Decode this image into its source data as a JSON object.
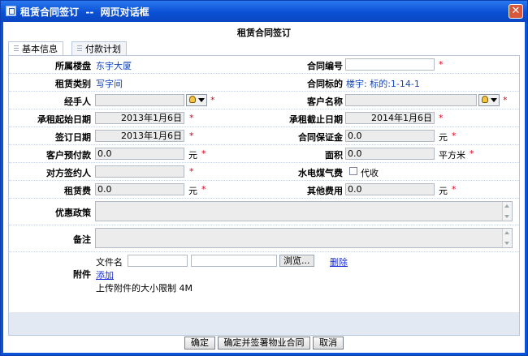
{
  "window": {
    "title": "租赁合同签订  --  网页对话框"
  },
  "form": {
    "title": "租赁合同签订"
  },
  "tabs": [
    {
      "label": "基本信息"
    },
    {
      "label": "付款计划"
    }
  ],
  "fields": {
    "building": {
      "label": "所属楼盘",
      "value": "东宇大厦"
    },
    "contract_no": {
      "label": "合同编号",
      "value": ""
    },
    "lease_type": {
      "label": "租赁类别",
      "value": "写字间"
    },
    "contract_target": {
      "label": "合同标的",
      "value": "楼宇: 标的:1-14-1"
    },
    "handler": {
      "label": "经手人",
      "value": ""
    },
    "customer": {
      "label": "客户名称",
      "value": ""
    },
    "start_date": {
      "label": "承租起始日期",
      "value": "2013年1月6日"
    },
    "end_date": {
      "label": "承租截止日期",
      "value": "2014年1月6日"
    },
    "sign_date": {
      "label": "签订日期",
      "value": "2013年1月6日"
    },
    "deposit": {
      "label": "合同保证金",
      "value": "0.0",
      "unit": "元"
    },
    "prepay": {
      "label": "客户预付款",
      "value": "0.0",
      "unit": "元"
    },
    "area": {
      "label": "面积",
      "value": "0.0",
      "unit": "平方米"
    },
    "signer": {
      "label": "对方签约人",
      "value": ""
    },
    "utilities": {
      "label": "水电煤气费",
      "checkbox_label": "代收",
      "checked": false
    },
    "rent": {
      "label": "租赁费",
      "value": "0.0",
      "unit": "元"
    },
    "other_fees": {
      "label": "其他费用",
      "value": "0.0",
      "unit": "元"
    },
    "discount": {
      "label": "优惠政策",
      "value": ""
    },
    "remarks": {
      "label": "备注",
      "value": ""
    },
    "attachment": {
      "label": "附件",
      "filename_label": "文件名",
      "browse_label": "浏览...",
      "delete_label": "删除",
      "add_label": "添加",
      "limit_text": "上传附件的大小限制 4M"
    }
  },
  "required_mark": "*",
  "buttons": {
    "ok": "确定",
    "ok_sign": "确定并签署物业合同",
    "cancel": "取消"
  },
  "colors": {
    "titlebar": "#0a50d4",
    "link": "#1646b8",
    "required": "#e0001b"
  }
}
